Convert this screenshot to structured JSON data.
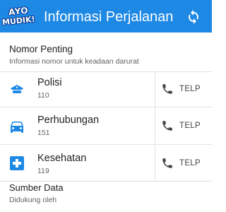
{
  "app": {
    "logo_line1": "AYO",
    "logo_line2": "MUDIK!",
    "title": "Informasi Perjalanan",
    "accent_color": "#1e88e5",
    "refresh_icon": "refresh-icon"
  },
  "section": {
    "title": "Nomor Penting",
    "subtitle": "Informasi nomor untuk keadaan darurat"
  },
  "contacts": [
    {
      "name": "Polisi",
      "number": "110",
      "icon": "police-hat-icon",
      "call_label": "TELP"
    },
    {
      "name": "Perhubungan",
      "number": "151",
      "icon": "car-icon",
      "call_label": "TELP"
    },
    {
      "name": "Kesehatan",
      "number": "119",
      "icon": "medical-cross-icon",
      "call_label": "TELP"
    }
  ],
  "footer": {
    "title": "Sumber Data",
    "subtitle": "Didukung oleh"
  }
}
